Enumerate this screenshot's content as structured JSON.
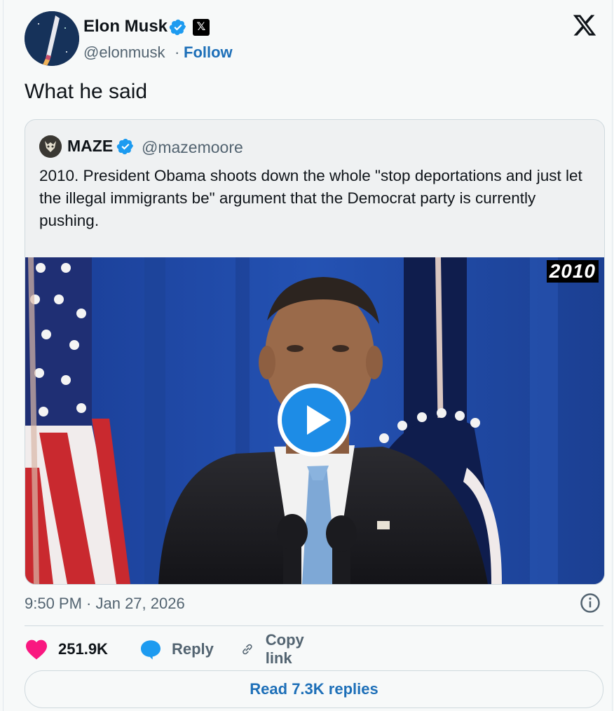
{
  "tweet": {
    "author_name": "Elon Musk",
    "author_handle": "@elonmusk",
    "separator": "·",
    "follow_label": "Follow",
    "text": "What he said",
    "timestamp": "9:50 PM · Jan 27, 2026"
  },
  "quote": {
    "author_name": "MAZE",
    "author_handle": "@mazemoore",
    "text": "2010. President Obama shoots down the whole \"stop deportations and just let the illegal immigrants be\" argument that the Democrat party is currently pushing.",
    "video_badge": "2010"
  },
  "actions": {
    "like_count": "251.9K",
    "reply_label": "Reply",
    "copy_link_label": "Copy link",
    "read_replies_label": "Read 7.3K replies"
  },
  "colors": {
    "link": "#1d6fb8",
    "verified": "#1d9bf0",
    "like": "#f91880",
    "reply_icon": "#1d9bf0",
    "play": "#1d8ce6"
  },
  "icons": [
    "verified-badge-icon",
    "x-affiliate-badge-icon",
    "x-logo-icon",
    "play-icon",
    "info-icon",
    "heart-icon",
    "speech-bubble-icon",
    "link-icon"
  ]
}
